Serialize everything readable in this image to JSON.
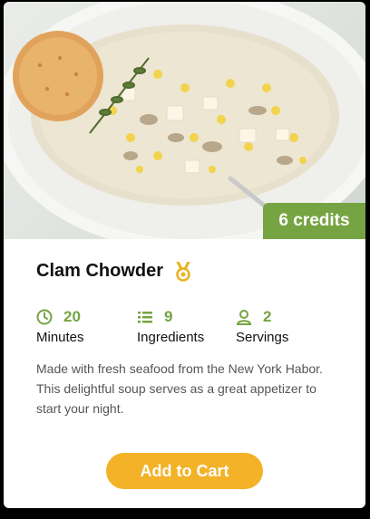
{
  "recipe": {
    "title": "Clam Chowder",
    "credits_badge": "6 credits",
    "description": "Made with fresh seafood from the New York Habor. This delightful soup serves as a great appetizer to start your night.",
    "cta_label": "Add to Cart",
    "stats": [
      {
        "icon": "clock-icon",
        "value": "20",
        "label": "Minutes"
      },
      {
        "icon": "list-icon",
        "value": "9",
        "label": "Ingredients"
      },
      {
        "icon": "person-icon",
        "value": "2",
        "label": "Servings"
      }
    ]
  },
  "colors": {
    "accent_green": "#76a442",
    "cta_yellow": "#f3b227",
    "badge_gold": "#e8b21f",
    "text_dark": "#111111",
    "text_muted": "#555555"
  },
  "icons": {
    "award": "medal-icon"
  }
}
